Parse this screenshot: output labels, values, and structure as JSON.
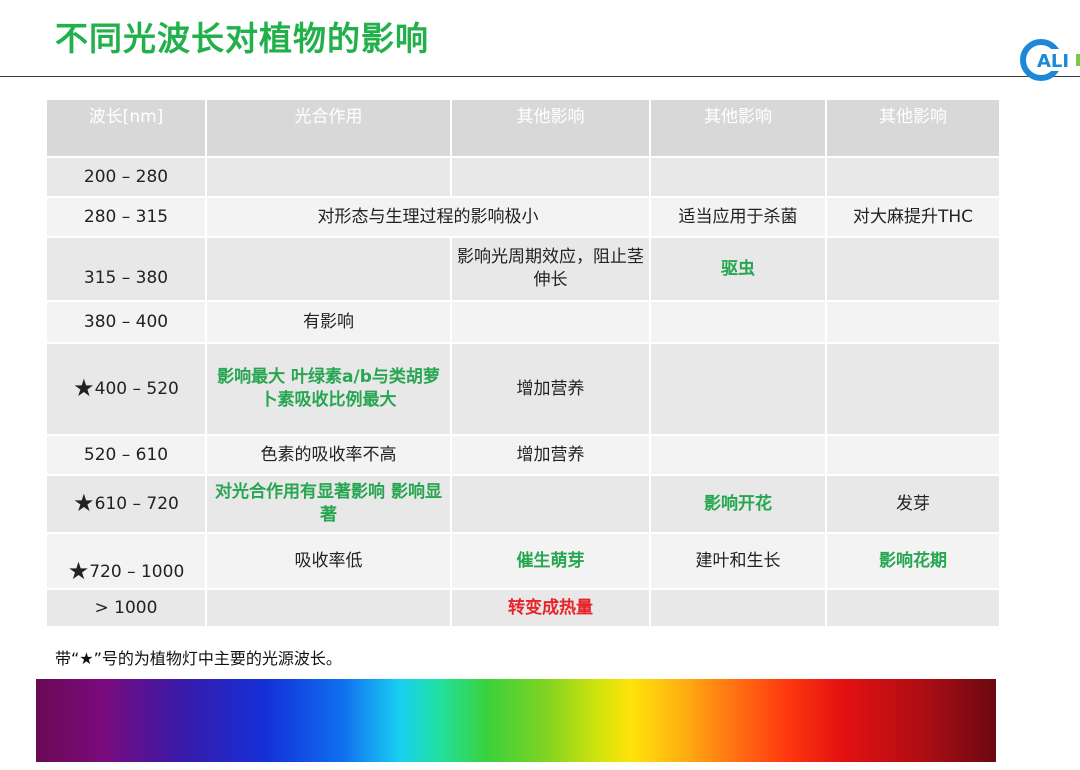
{
  "title": "不同光波长对植物的影响",
  "logo_text": "ALI",
  "colors": {
    "title_green": "#22b04b",
    "highlight_green": "#27a651",
    "highlight_red": "#e5252a",
    "header_bg": "#d8d8d8"
  },
  "table": {
    "headers": [
      "波长[nm]",
      "光合作用",
      "其他影响",
      "其他影响",
      "其他影响"
    ],
    "rows": [
      {
        "wavelength": "200 – 280"
      },
      {
        "wavelength": "280 – 315",
        "photosynthesis_span": "对形态与生理过程的影响极小",
        "other2": "适当应用于杀菌",
        "other3": "对大麻提升THC"
      },
      {
        "wavelength": "315 – 380",
        "other1": "影响光周期效应，阻止茎伸长",
        "other2": "驱虫"
      },
      {
        "wavelength": "380 – 400",
        "photosynthesis": "有影响"
      },
      {
        "star": "★",
        "wavelength": "400 – 520",
        "photosynthesis": "影响最大 叶绿素a/b与类胡萝卜素吸收比例最大",
        "other1": "增加营养"
      },
      {
        "wavelength": "520 – 610",
        "photosynthesis": "色素的吸收率不高",
        "other1": "增加营养"
      },
      {
        "star": "★",
        "wavelength": "610 – 720",
        "photosynthesis": "对光合作用有显著影响 影响显著",
        "other2": "影响开花",
        "other3": "发芽"
      },
      {
        "star": "★",
        "wavelength": "720 – 1000",
        "photosynthesis": "吸收率低",
        "other1": "催生萌芽",
        "other2": "建叶和生长",
        "other3": "影响花期"
      },
      {
        "wavelength": "> 1000",
        "other1": "转变成热量"
      }
    ]
  },
  "footnote": "带“★”号的为植物灯中主要的光源波长。"
}
